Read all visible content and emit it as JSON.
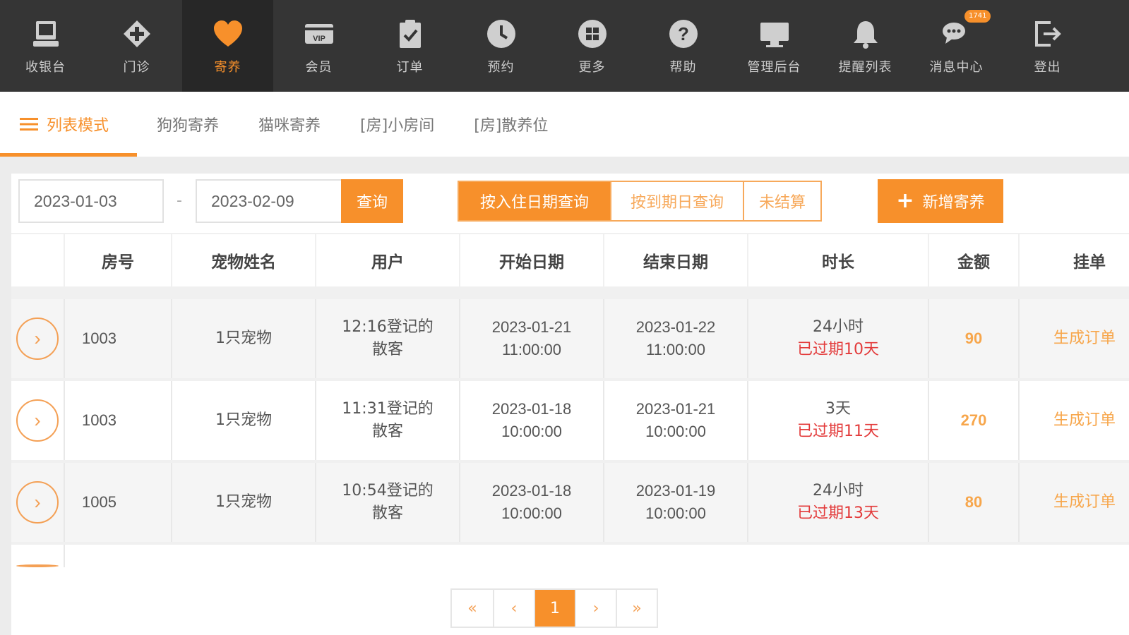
{
  "nav": [
    {
      "label": "收银台",
      "icon": "cashier-icon"
    },
    {
      "label": "门诊",
      "icon": "clinic-cross-icon"
    },
    {
      "label": "寄养",
      "icon": "heart-icon",
      "active": true
    },
    {
      "label": "会员",
      "icon": "vip-card-icon"
    },
    {
      "label": "订单",
      "icon": "clipboard-icon"
    },
    {
      "label": "预约",
      "icon": "clock-icon"
    },
    {
      "label": "更多",
      "icon": "grid-icon"
    },
    {
      "label": "帮助",
      "icon": "help-icon"
    },
    {
      "label": "管理后台",
      "icon": "monitor-icon"
    },
    {
      "label": "提醒列表",
      "icon": "bell-icon"
    },
    {
      "label": "消息中心",
      "icon": "chat-icon",
      "badge": "1741"
    },
    {
      "label": "登出",
      "icon": "logout-icon"
    }
  ],
  "subtabs": [
    "列表模式",
    "狗狗寄养",
    "猫咪寄养",
    "[房]小房间",
    "[房]散养位"
  ],
  "filters": {
    "start_date": "2023-01-03",
    "separator": "-",
    "end_date": "2023-02-09",
    "query_label": "查询",
    "segments": [
      "按入住日期查询",
      "按到期日查询",
      "未结算"
    ],
    "add_label": "新增寄养"
  },
  "table": {
    "headers": [
      "",
      "房号",
      "宠物姓名",
      "用户",
      "开始日期",
      "结束日期",
      "时长",
      "金额",
      "挂单"
    ],
    "rows": [
      {
        "room": "1003",
        "pet": "1只宠物",
        "user_line1": "12:16登记的",
        "user_line2": "散客",
        "start_date": "2023-01-21",
        "start_time": "11:00:00",
        "end_date": "2023-01-22",
        "end_time": "11:00:00",
        "duration": "24小时",
        "expired": "已过期10天",
        "amount": "90",
        "action": "生成订单"
      },
      {
        "room": "1003",
        "pet": "1只宠物",
        "user_line1": "11:31登记的",
        "user_line2": "散客",
        "start_date": "2023-01-18",
        "start_time": "10:00:00",
        "end_date": "2023-01-21",
        "end_time": "10:00:00",
        "duration": "3天",
        "expired": "已过期11天",
        "amount": "270",
        "action": "生成订单"
      },
      {
        "room": "1005",
        "pet": "1只宠物",
        "user_line1": "10:54登记的",
        "user_line2": "散客",
        "start_date": "2023-01-18",
        "start_time": "10:00:00",
        "end_date": "2023-01-19",
        "end_time": "10:00:00",
        "duration": "24小时",
        "expired": "已过期13天",
        "amount": "80",
        "action": "生成订单"
      }
    ]
  },
  "pagination": {
    "first": "«",
    "prev": "‹",
    "current": "1",
    "next": "›",
    "last": "»"
  },
  "colors": {
    "accent": "#f7902b",
    "nav_bg": "#353535",
    "expired": "#e33b3b"
  }
}
